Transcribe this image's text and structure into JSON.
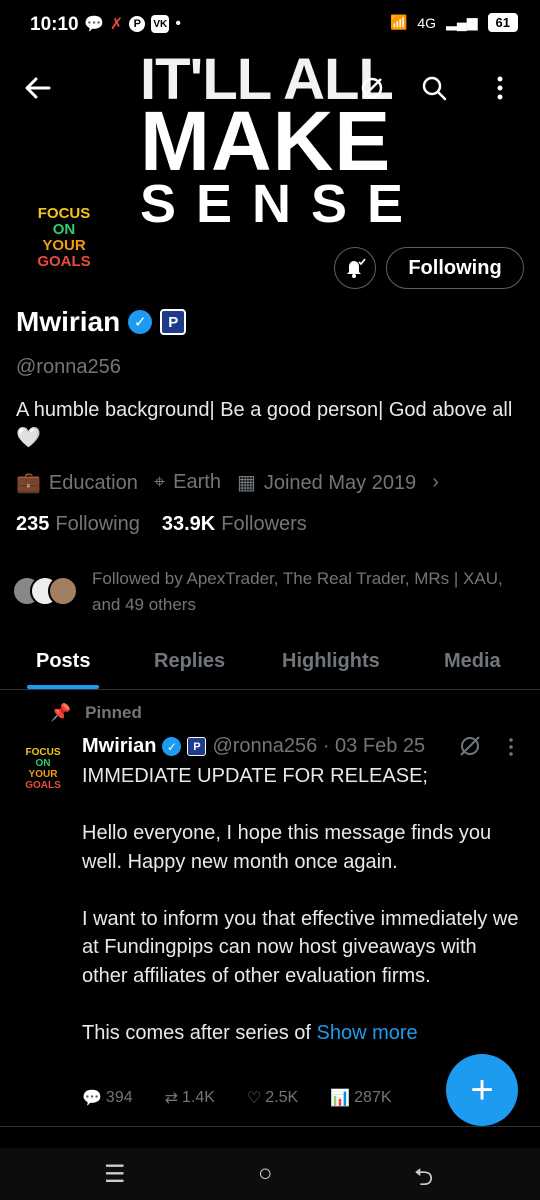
{
  "status_bar": {
    "time": "10:10",
    "battery": "61",
    "network": "4G"
  },
  "banner": {
    "line1": "IT'LL ALL",
    "line2": "MAKE",
    "line3": "SENSE"
  },
  "profile_avatar": {
    "lines": [
      "FOCUS",
      "ON",
      "YOUR",
      "GOALS"
    ]
  },
  "actions": {
    "follow_label": "Following"
  },
  "profile": {
    "name": "Mwirian",
    "handle": "@ronna256",
    "bio": "A humble background| Be a good person| God above all 🤍",
    "category": "Education",
    "location": "Earth",
    "joined": "Joined May 2019",
    "following_count": "235",
    "following_label": "Following",
    "followers_count": "33.9K",
    "followers_label": "Followers",
    "followed_by": "Followed by ApexTrader, The Real Trader, MRs | XAU, and 49 others"
  },
  "tabs": [
    {
      "label": "Posts",
      "active": true
    },
    {
      "label": "Replies"
    },
    {
      "label": "Highlights"
    },
    {
      "label": "Media"
    }
  ],
  "post": {
    "pinned_label": "Pinned",
    "author": "Mwirian",
    "handle_date": "@ronna256 · 03 Feb 25",
    "paragraphs": [
      "IMMEDIATE UPDATE FOR RELEASE;",
      "Hello everyone, I hope this message finds you well. Happy new month once again.",
      "I want to inform you that effective immediately we at Fundingpips can now host giveaways with other affiliates of other evaluation firms."
    ],
    "last_line": "This comes after series of ",
    "show_more": "Show more",
    "replies": "394",
    "reposts": "1.4K",
    "likes": "2.5K",
    "views": "287K"
  },
  "colors": {
    "accent": "#1d9bf0",
    "muted": "#71767b",
    "background": "#000000"
  }
}
